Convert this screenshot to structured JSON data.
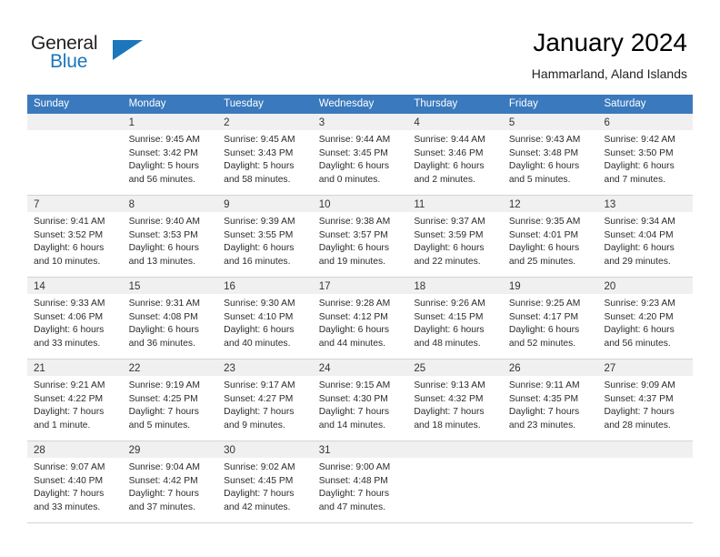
{
  "brand": {
    "word1": "General",
    "word2": "Blue",
    "logo_icon": "triangle-logo-icon",
    "accent_color": "#1b76bc"
  },
  "header": {
    "title": "January 2024",
    "subtitle": "Hammarland, Aland Islands"
  },
  "calendar": {
    "header_color": "#3a79bd",
    "daynum_bar_color": "#f0f0f0",
    "weekdays": [
      "Sunday",
      "Monday",
      "Tuesday",
      "Wednesday",
      "Thursday",
      "Friday",
      "Saturday"
    ],
    "weeks": [
      [
        {
          "day": "",
          "lines": []
        },
        {
          "day": "1",
          "lines": [
            "Sunrise: 9:45 AM",
            "Sunset: 3:42 PM",
            "Daylight: 5 hours",
            "and 56 minutes."
          ]
        },
        {
          "day": "2",
          "lines": [
            "Sunrise: 9:45 AM",
            "Sunset: 3:43 PM",
            "Daylight: 5 hours",
            "and 58 minutes."
          ]
        },
        {
          "day": "3",
          "lines": [
            "Sunrise: 9:44 AM",
            "Sunset: 3:45 PM",
            "Daylight: 6 hours",
            "and 0 minutes."
          ]
        },
        {
          "day": "4",
          "lines": [
            "Sunrise: 9:44 AM",
            "Sunset: 3:46 PM",
            "Daylight: 6 hours",
            "and 2 minutes."
          ]
        },
        {
          "day": "5",
          "lines": [
            "Sunrise: 9:43 AM",
            "Sunset: 3:48 PM",
            "Daylight: 6 hours",
            "and 5 minutes."
          ]
        },
        {
          "day": "6",
          "lines": [
            "Sunrise: 9:42 AM",
            "Sunset: 3:50 PM",
            "Daylight: 6 hours",
            "and 7 minutes."
          ]
        }
      ],
      [
        {
          "day": "7",
          "lines": [
            "Sunrise: 9:41 AM",
            "Sunset: 3:52 PM",
            "Daylight: 6 hours",
            "and 10 minutes."
          ]
        },
        {
          "day": "8",
          "lines": [
            "Sunrise: 9:40 AM",
            "Sunset: 3:53 PM",
            "Daylight: 6 hours",
            "and 13 minutes."
          ]
        },
        {
          "day": "9",
          "lines": [
            "Sunrise: 9:39 AM",
            "Sunset: 3:55 PM",
            "Daylight: 6 hours",
            "and 16 minutes."
          ]
        },
        {
          "day": "10",
          "lines": [
            "Sunrise: 9:38 AM",
            "Sunset: 3:57 PM",
            "Daylight: 6 hours",
            "and 19 minutes."
          ]
        },
        {
          "day": "11",
          "lines": [
            "Sunrise: 9:37 AM",
            "Sunset: 3:59 PM",
            "Daylight: 6 hours",
            "and 22 minutes."
          ]
        },
        {
          "day": "12",
          "lines": [
            "Sunrise: 9:35 AM",
            "Sunset: 4:01 PM",
            "Daylight: 6 hours",
            "and 25 minutes."
          ]
        },
        {
          "day": "13",
          "lines": [
            "Sunrise: 9:34 AM",
            "Sunset: 4:04 PM",
            "Daylight: 6 hours",
            "and 29 minutes."
          ]
        }
      ],
      [
        {
          "day": "14",
          "lines": [
            "Sunrise: 9:33 AM",
            "Sunset: 4:06 PM",
            "Daylight: 6 hours",
            "and 33 minutes."
          ]
        },
        {
          "day": "15",
          "lines": [
            "Sunrise: 9:31 AM",
            "Sunset: 4:08 PM",
            "Daylight: 6 hours",
            "and 36 minutes."
          ]
        },
        {
          "day": "16",
          "lines": [
            "Sunrise: 9:30 AM",
            "Sunset: 4:10 PM",
            "Daylight: 6 hours",
            "and 40 minutes."
          ]
        },
        {
          "day": "17",
          "lines": [
            "Sunrise: 9:28 AM",
            "Sunset: 4:12 PM",
            "Daylight: 6 hours",
            "and 44 minutes."
          ]
        },
        {
          "day": "18",
          "lines": [
            "Sunrise: 9:26 AM",
            "Sunset: 4:15 PM",
            "Daylight: 6 hours",
            "and 48 minutes."
          ]
        },
        {
          "day": "19",
          "lines": [
            "Sunrise: 9:25 AM",
            "Sunset: 4:17 PM",
            "Daylight: 6 hours",
            "and 52 minutes."
          ]
        },
        {
          "day": "20",
          "lines": [
            "Sunrise: 9:23 AM",
            "Sunset: 4:20 PM",
            "Daylight: 6 hours",
            "and 56 minutes."
          ]
        }
      ],
      [
        {
          "day": "21",
          "lines": [
            "Sunrise: 9:21 AM",
            "Sunset: 4:22 PM",
            "Daylight: 7 hours",
            "and 1 minute."
          ]
        },
        {
          "day": "22",
          "lines": [
            "Sunrise: 9:19 AM",
            "Sunset: 4:25 PM",
            "Daylight: 7 hours",
            "and 5 minutes."
          ]
        },
        {
          "day": "23",
          "lines": [
            "Sunrise: 9:17 AM",
            "Sunset: 4:27 PM",
            "Daylight: 7 hours",
            "and 9 minutes."
          ]
        },
        {
          "day": "24",
          "lines": [
            "Sunrise: 9:15 AM",
            "Sunset: 4:30 PM",
            "Daylight: 7 hours",
            "and 14 minutes."
          ]
        },
        {
          "day": "25",
          "lines": [
            "Sunrise: 9:13 AM",
            "Sunset: 4:32 PM",
            "Daylight: 7 hours",
            "and 18 minutes."
          ]
        },
        {
          "day": "26",
          "lines": [
            "Sunrise: 9:11 AM",
            "Sunset: 4:35 PM",
            "Daylight: 7 hours",
            "and 23 minutes."
          ]
        },
        {
          "day": "27",
          "lines": [
            "Sunrise: 9:09 AM",
            "Sunset: 4:37 PM",
            "Daylight: 7 hours",
            "and 28 minutes."
          ]
        }
      ],
      [
        {
          "day": "28",
          "lines": [
            "Sunrise: 9:07 AM",
            "Sunset: 4:40 PM",
            "Daylight: 7 hours",
            "and 33 minutes."
          ]
        },
        {
          "day": "29",
          "lines": [
            "Sunrise: 9:04 AM",
            "Sunset: 4:42 PM",
            "Daylight: 7 hours",
            "and 37 minutes."
          ]
        },
        {
          "day": "30",
          "lines": [
            "Sunrise: 9:02 AM",
            "Sunset: 4:45 PM",
            "Daylight: 7 hours",
            "and 42 minutes."
          ]
        },
        {
          "day": "31",
          "lines": [
            "Sunrise: 9:00 AM",
            "Sunset: 4:48 PM",
            "Daylight: 7 hours",
            "and 47 minutes."
          ]
        },
        {
          "day": "",
          "lines": []
        },
        {
          "day": "",
          "lines": []
        },
        {
          "day": "",
          "lines": []
        }
      ]
    ]
  }
}
